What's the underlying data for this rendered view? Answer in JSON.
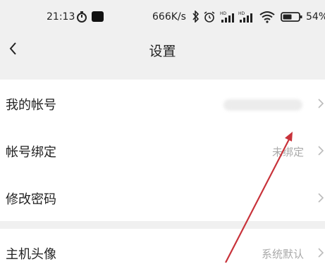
{
  "status_bar": {
    "time": "21:13",
    "network_speed": "666K/s",
    "battery": "54%"
  },
  "nav": {
    "title": "设置"
  },
  "settings": {
    "my_account_label": "我的帐号",
    "account_binding_label": "帐号绑定",
    "account_binding_value": "未绑定",
    "change_password_label": "修改密码",
    "host_avatar_label": "主机头像",
    "host_avatar_value": "系统默认"
  },
  "colors": {
    "annotation_arrow": "#c8323a"
  }
}
